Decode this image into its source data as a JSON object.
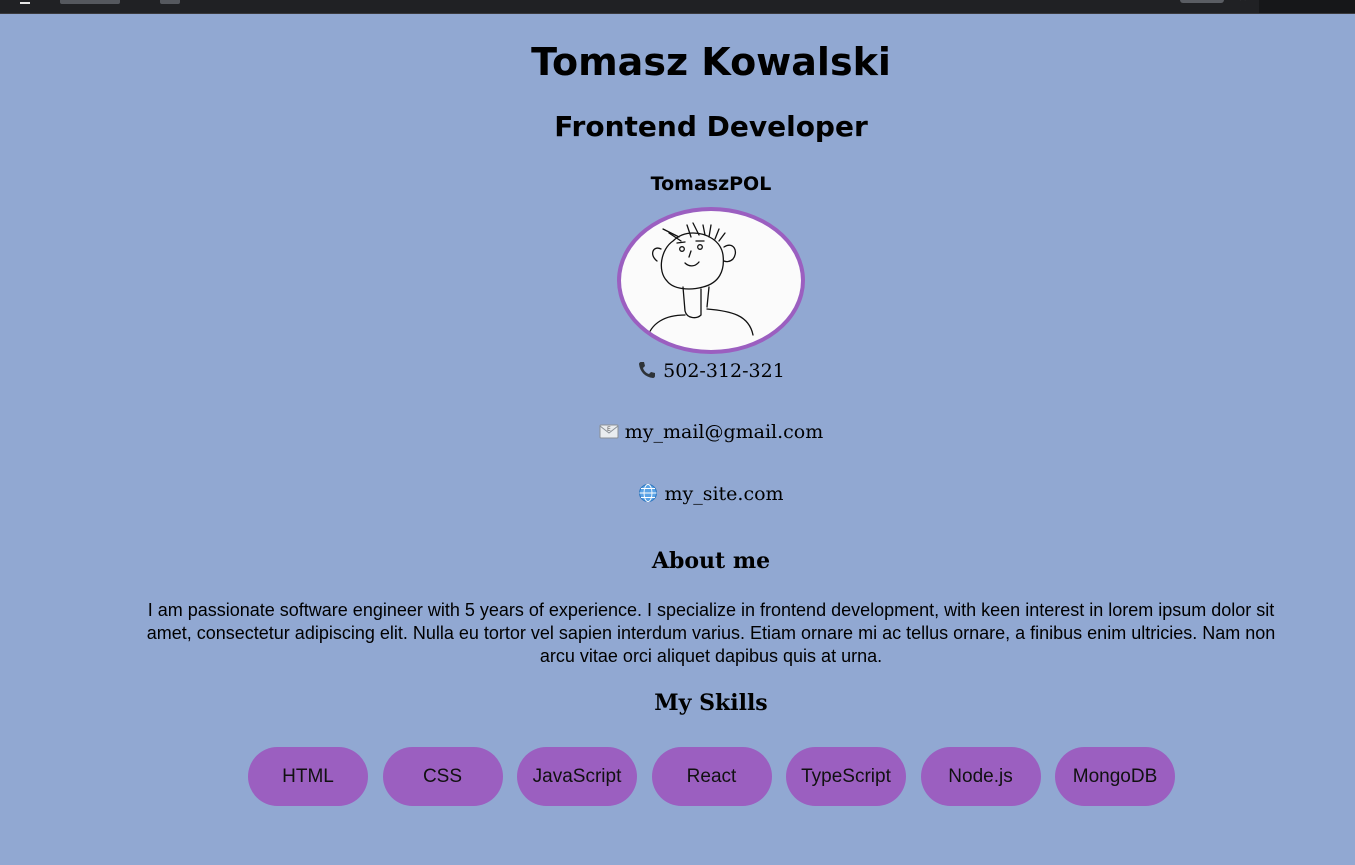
{
  "profile": {
    "name": "Tomasz Kowalski",
    "role": "Frontend Developer",
    "nickname": "TomaszPOL"
  },
  "contact": {
    "phone": "502-312-321",
    "email": "my_mail@gmail.com",
    "site": "my_site.com",
    "phone_icon": "phone-icon",
    "email_icon": "envelope-icon",
    "site_icon": "globe-icon"
  },
  "about": {
    "title": "About me",
    "text": "I am passionate software engineer with 5 years of experience. I specialize in frontend development, with keen interest in lorem ipsum dolor sit amet, consectetur adipiscing elit. Nulla eu tortor vel sapien interdum varius. Etiam ornare mi ac tellus ornare, a finibus enim ultricies. Nam non arcu vitae orci aliquet dapibus quis at urna."
  },
  "skills": {
    "title": "My Skills",
    "items": [
      "HTML",
      "CSS",
      "JavaScript",
      "React",
      "TypeScript",
      "Node.js",
      "MongoDB"
    ]
  },
  "colors": {
    "background": "#91a8d2",
    "accent": "#9b5fc0",
    "topbar": "#202124"
  }
}
